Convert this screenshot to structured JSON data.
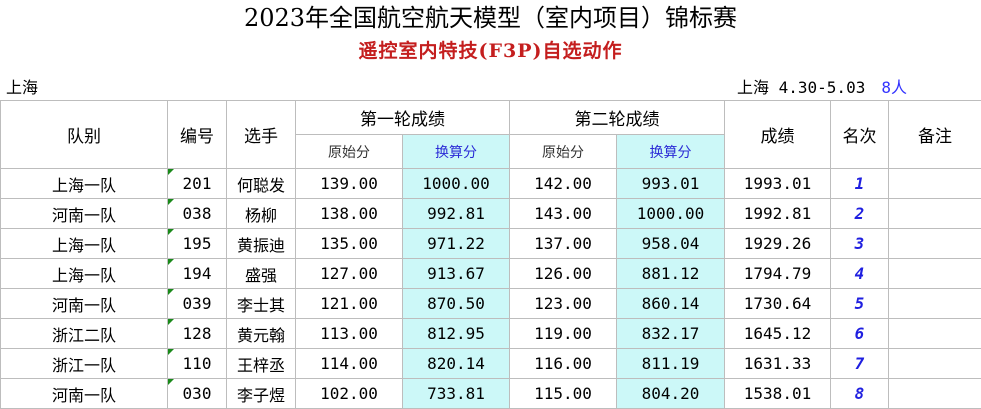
{
  "header": {
    "title": "2023年全国航空航天模型（室内项目）锦标赛",
    "subtitle": "遥控室内特技(F3P)自选动作",
    "location": "上海",
    "date_info": "上海 4.30-5.03",
    "participant_count": "8人"
  },
  "colors": {
    "subtitle": "#c41e1e",
    "count": "#3232ff",
    "highlight_column": "#ccf8f8",
    "rank": "#1f1fe0",
    "corner_marker": "#1a8a1a"
  },
  "columns": {
    "team": "队别",
    "number": "编号",
    "pilot": "选手",
    "round1": "第一轮成绩",
    "round2": "第二轮成绩",
    "raw": "原始分",
    "converted": "换算分",
    "score": "成绩",
    "rank": "名次",
    "notes": "备注"
  },
  "rows": [
    {
      "team": "上海一队",
      "number": "201",
      "pilot": "何聪发",
      "r1_raw": "139.00",
      "r1_conv": "1000.00",
      "r2_raw": "142.00",
      "r2_conv": "993.01",
      "score": "1993.01",
      "rank": "1",
      "notes": ""
    },
    {
      "team": "河南一队",
      "number": "038",
      "pilot": "杨柳",
      "r1_raw": "138.00",
      "r1_conv": "992.81",
      "r2_raw": "143.00",
      "r2_conv": "1000.00",
      "score": "1992.81",
      "rank": "2",
      "notes": ""
    },
    {
      "team": "上海一队",
      "number": "195",
      "pilot": "黄振迪",
      "r1_raw": "135.00",
      "r1_conv": "971.22",
      "r2_raw": "137.00",
      "r2_conv": "958.04",
      "score": "1929.26",
      "rank": "3",
      "notes": ""
    },
    {
      "team": "上海一队",
      "number": "194",
      "pilot": "盛强",
      "r1_raw": "127.00",
      "r1_conv": "913.67",
      "r2_raw": "126.00",
      "r2_conv": "881.12",
      "score": "1794.79",
      "rank": "4",
      "notes": ""
    },
    {
      "team": "河南一队",
      "number": "039",
      "pilot": "李士其",
      "r1_raw": "121.00",
      "r1_conv": "870.50",
      "r2_raw": "123.00",
      "r2_conv": "860.14",
      "score": "1730.64",
      "rank": "5",
      "notes": ""
    },
    {
      "team": "浙江二队",
      "number": "128",
      "pilot": "黄元翰",
      "r1_raw": "113.00",
      "r1_conv": "812.95",
      "r2_raw": "119.00",
      "r2_conv": "832.17",
      "score": "1645.12",
      "rank": "6",
      "notes": ""
    },
    {
      "team": "浙江一队",
      "number": "110",
      "pilot": "王梓丞",
      "r1_raw": "114.00",
      "r1_conv": "820.14",
      "r2_raw": "116.00",
      "r2_conv": "811.19",
      "score": "1631.33",
      "rank": "7",
      "notes": ""
    },
    {
      "team": "河南一队",
      "number": "030",
      "pilot": "李子煜",
      "r1_raw": "102.00",
      "r1_conv": "733.81",
      "r2_raw": "115.00",
      "r2_conv": "804.20",
      "score": "1538.01",
      "rank": "8",
      "notes": ""
    }
  ]
}
